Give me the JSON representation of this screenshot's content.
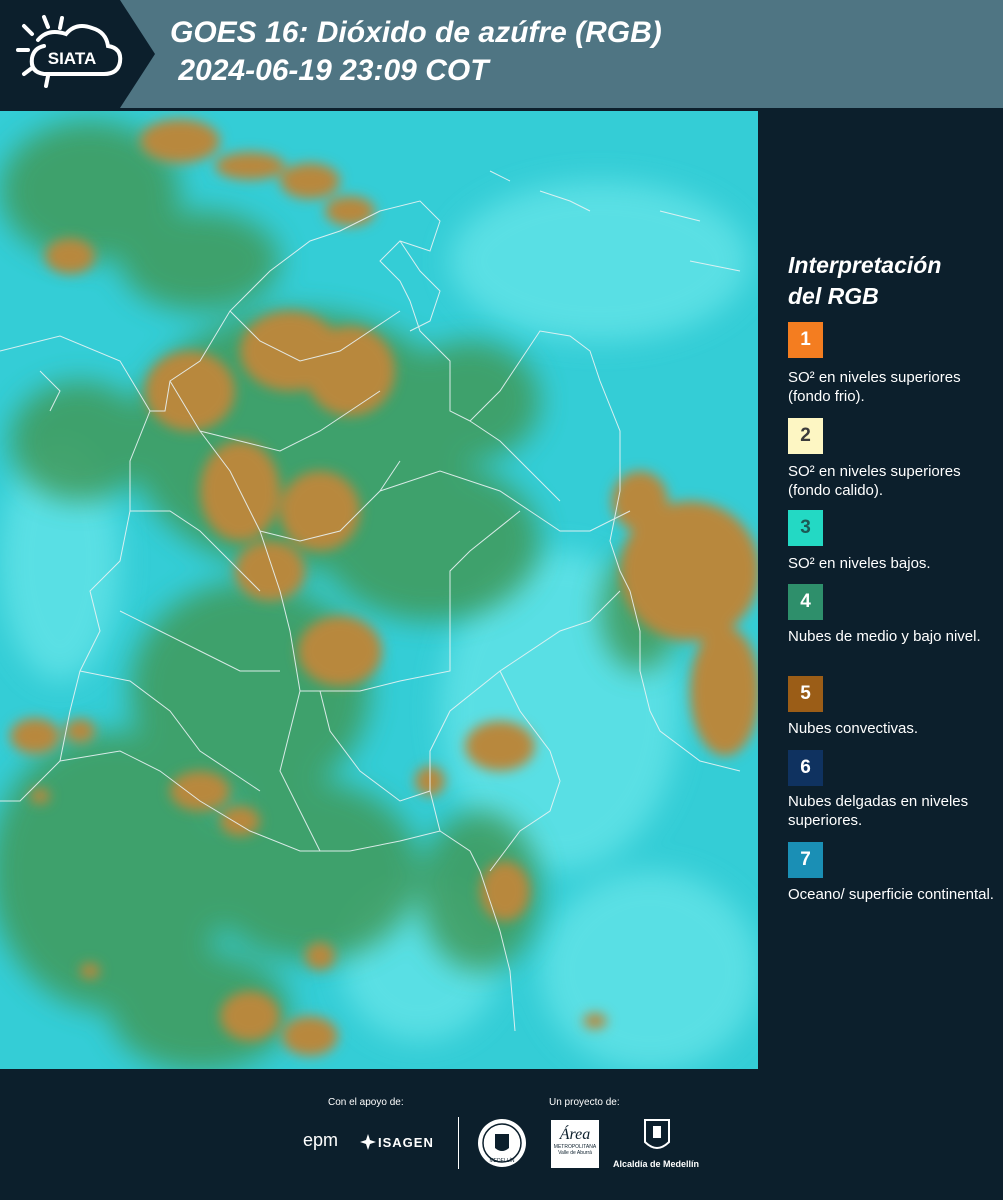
{
  "header": {
    "logo_text": "SIATA",
    "title": "GOES 16: Dióxido de azúfre (RGB)\n 2024-06-19 23:09 COT"
  },
  "map": {
    "layer_name": "GOES 16: Dióxido de azúfre (RGB)",
    "colors": {
      "background": "#34cdd6",
      "ocean_surface": "#5fe3e6",
      "midlow_clouds": "#3f9a5a",
      "convective": "#b8883c",
      "borders": "#e9f3f4"
    }
  },
  "legend": {
    "title": "Interpretación\ndel RGB",
    "items": [
      {
        "number": "1",
        "color": "#f47d20",
        "text": "SO² en niveles superiores (fondo frio)."
      },
      {
        "number": "2",
        "color": "#fdf6c3",
        "text": "SO² en niveles superiores (fondo calido)."
      },
      {
        "number": "3",
        "color": "#23d9c4",
        "text": "SO² en niveles bajos."
      },
      {
        "number": "4",
        "color": "#2e8f6b",
        "text": "Nubes de medio y bajo nivel."
      },
      {
        "number": "5",
        "color": "#9b5d17",
        "text": "Nubes convectivas."
      },
      {
        "number": "6",
        "color": "#0f3260",
        "text": "Nubes delgadas en niveles superiores."
      },
      {
        "number": "7",
        "color": "#1a8fb5",
        "text": "Oceano/ superficie continental."
      }
    ]
  },
  "footer": {
    "support_label": "Con el apoyo de:",
    "project_label": "Un proyecto de:",
    "sponsors": [
      "epm",
      "ISAGEN"
    ],
    "seal_text": "MEDELLÍN",
    "area_name": "Área",
    "area_sub": "METROPOLITANA",
    "area_sub2": "Valle de Aburrá",
    "alcaldia": "Alcaldía de Medellín"
  }
}
